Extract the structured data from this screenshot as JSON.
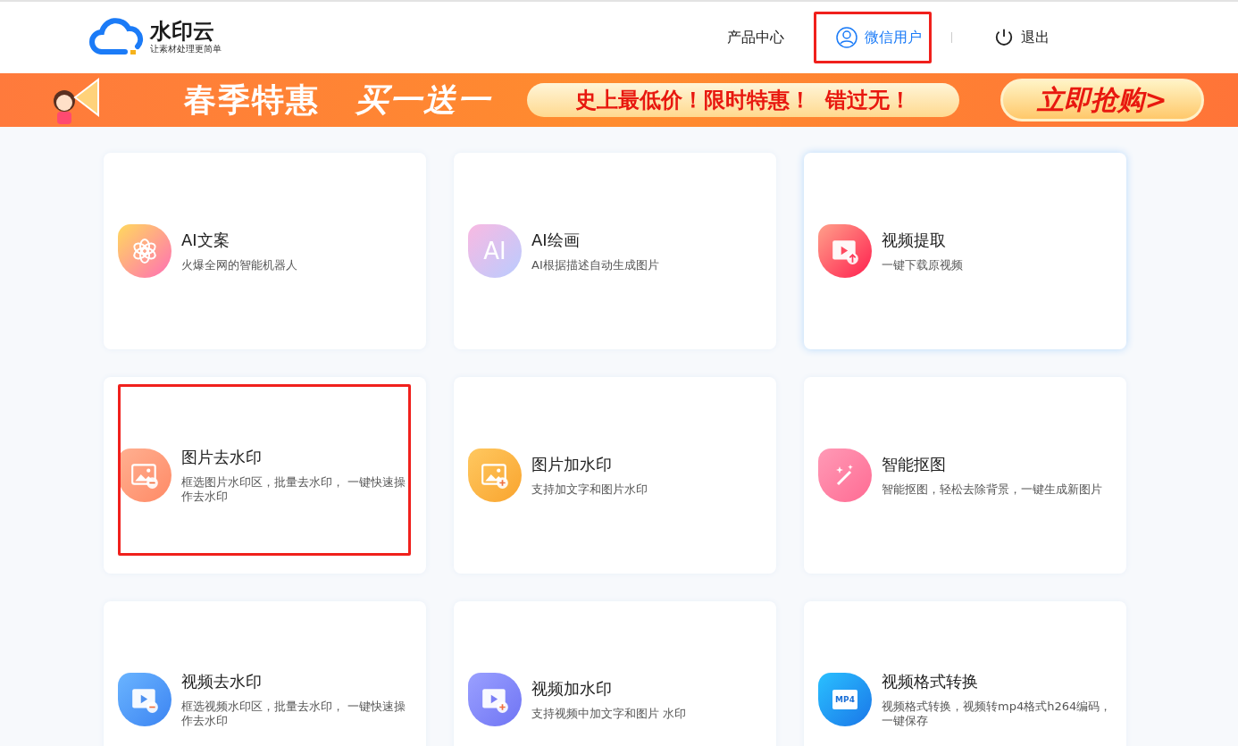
{
  "header": {
    "logo": {
      "name": "水印云",
      "tagline": "让素材处理更简单"
    },
    "nav": [
      {
        "kind": "link",
        "label": "产品中心",
        "highlighted": false
      },
      {
        "kind": "user",
        "label": "微信用户",
        "highlighted": true
      },
      {
        "kind": "logout",
        "label": "退出",
        "highlighted": false
      }
    ]
  },
  "banner": {
    "headline": "春季特惠",
    "offer": "买一送一",
    "slogan": "史上最低价！限时特惠！  错过无！",
    "cta": "立即抢购>"
  },
  "cards": [
    {
      "kind": "ai-chat",
      "title": "AI文案",
      "description": "火爆全网的智能机器人",
      "hovered": false,
      "highlighted": false
    },
    {
      "kind": "ai-paint",
      "icon_text": "AI",
      "title": "AI绘画",
      "description": "AI根据描述自动生成图片",
      "hovered": false,
      "highlighted": false
    },
    {
      "kind": "video-up",
      "title": "视频提取",
      "description": "一键下载原视频",
      "hovered": true,
      "highlighted": false
    },
    {
      "kind": "image-minus",
      "title": "图片去水印",
      "description": "框选图片水印区，批量去水印， 一键快速操作去水印",
      "hovered": false,
      "highlighted": true
    },
    {
      "kind": "image-plus",
      "title": "图片加水印",
      "description": "支持加文字和图片水印",
      "hovered": false,
      "highlighted": false
    },
    {
      "kind": "wand",
      "title": "智能抠图",
      "description": "智能抠图，轻松去除背景，一键生成新图片",
      "hovered": false,
      "highlighted": false
    },
    {
      "kind": "video-minus",
      "title": "视频去水印",
      "description": "框选视频水印区，批量去水印， 一键快速操作去水印",
      "hovered": false,
      "highlighted": false
    },
    {
      "kind": "video-plus",
      "title": "视频加水印",
      "description": "支持视频中加文字和图片 水印",
      "hovered": false,
      "highlighted": false
    },
    {
      "kind": "mp4",
      "icon_text": "MP4",
      "title": "视频格式转换",
      "description": "视频格式转换，视频转mp4格式h264编码，一键保存",
      "hovered": false,
      "highlighted": false
    }
  ]
}
